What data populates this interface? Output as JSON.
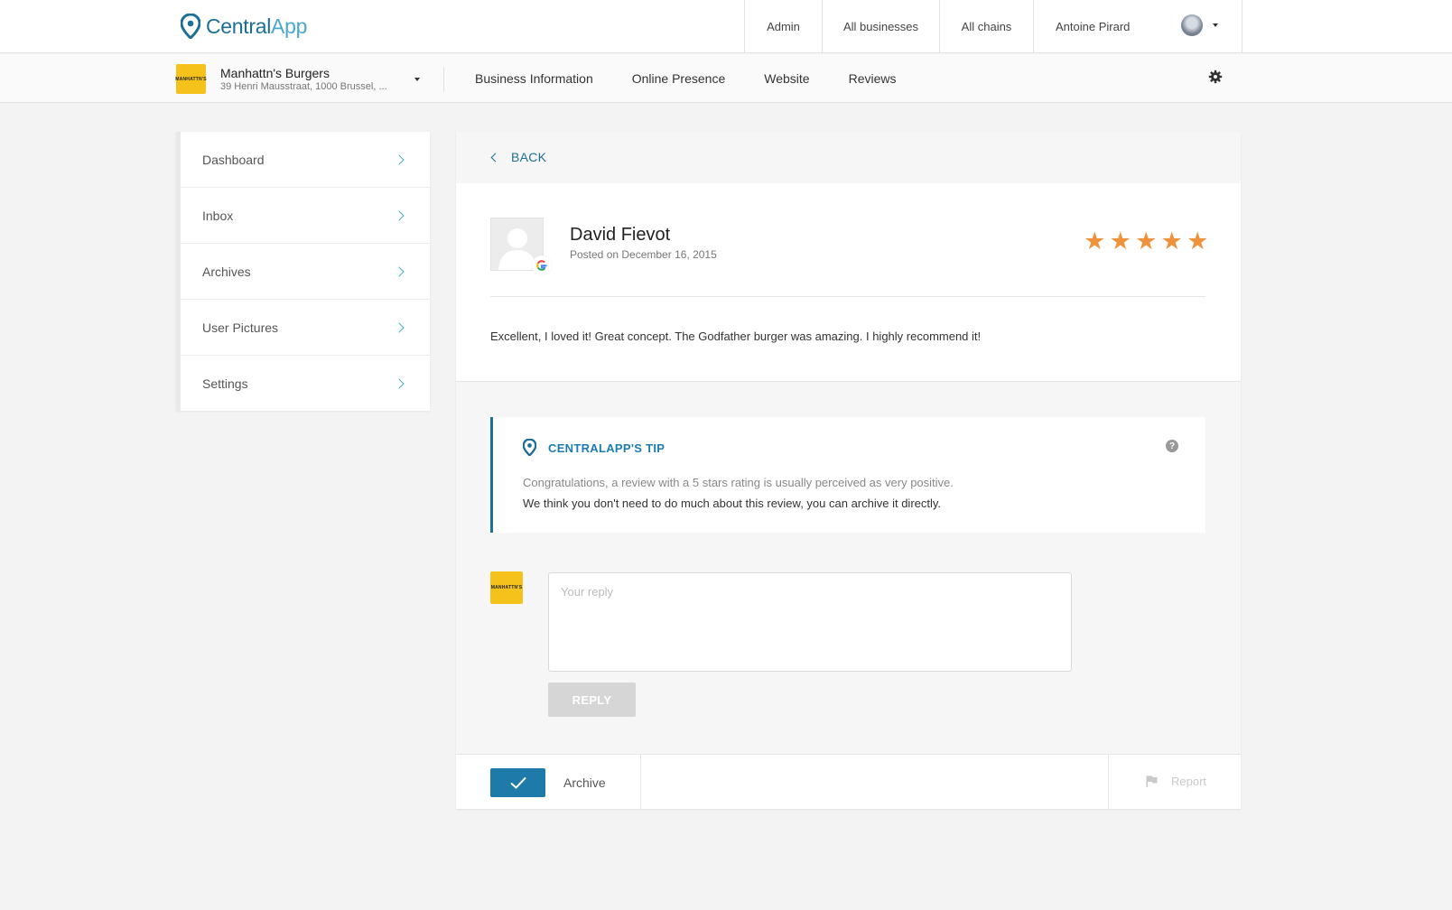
{
  "header": {
    "logo_central": "Central",
    "logo_app": "App",
    "nav": {
      "admin": "Admin",
      "all_businesses": "All businesses",
      "all_chains": "All chains",
      "user_name": "Antoine Pirard"
    }
  },
  "business": {
    "name": "Manhattn's Burgers",
    "address": "39 Henri Mausstraat, 1000 Brussel, ...",
    "logo_text": "MANHATTN'S"
  },
  "subnav": {
    "tabs": [
      "Business Information",
      "Online Presence",
      "Website",
      "Reviews"
    ]
  },
  "sidebar": {
    "items": [
      {
        "label": "Dashboard"
      },
      {
        "label": "Inbox"
      },
      {
        "label": "Archives"
      },
      {
        "label": "User Pictures"
      },
      {
        "label": "Settings"
      }
    ]
  },
  "main": {
    "back_label": "BACK",
    "review": {
      "reviewer": "David Fievot",
      "date": "Posted on December 16, 2015",
      "rating": 5,
      "max_rating": 5,
      "text": "Excellent, I loved it! Great concept. The Godfather burger was amazing. I highly recommend it!"
    },
    "tip": {
      "title": "CENTRALAPP'S TIP",
      "line1": "Congratulations, a review with a 5 stars rating is usually perceived as very positive.",
      "line2": "We think you don't need to do much about this review, you can archive it directly."
    },
    "reply": {
      "placeholder": "Your reply",
      "button": "REPLY"
    },
    "footer": {
      "archive": "Archive",
      "report": "Report"
    }
  },
  "colors": {
    "brand": "#1c6f96",
    "brand_light": "#4aa7cf",
    "star": "#f0913c",
    "business_logo": "#f4c21b",
    "archive_button": "#1e7aa8"
  }
}
